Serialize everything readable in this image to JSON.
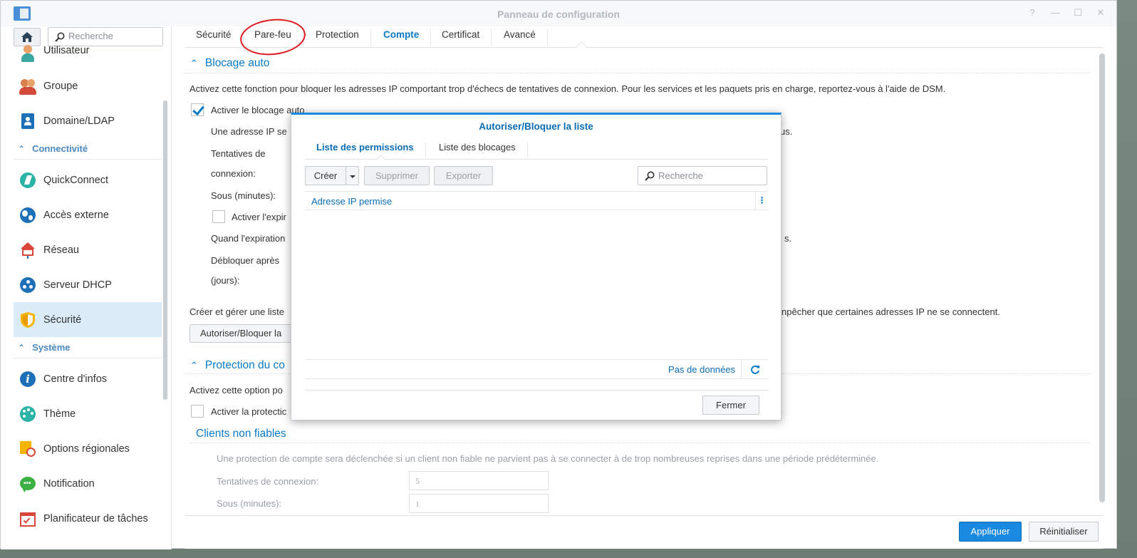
{
  "window": {
    "title": "Panneau de configuration",
    "controls": [
      "?",
      "—",
      "☐",
      "✕"
    ]
  },
  "sidebar": {
    "search_placeholder": "Recherche",
    "items": [
      {
        "label": "Utilisateur",
        "icon": "user-icon"
      },
      {
        "label": "Groupe",
        "icon": "group-icon"
      },
      {
        "label": "Domaine/LDAP",
        "icon": "domain-icon"
      }
    ],
    "section_connectivity": "Connectivité",
    "connectivity_items": [
      {
        "label": "QuickConnect",
        "icon": "quickconnect-icon"
      },
      {
        "label": "Accès externe",
        "icon": "globe-icon"
      },
      {
        "label": "Réseau",
        "icon": "network-house-icon"
      },
      {
        "label": "Serveur DHCP",
        "icon": "dhcp-icon"
      },
      {
        "label": "Sécurité",
        "icon": "shield-icon",
        "active": true
      }
    ],
    "section_system": "Système",
    "system_items": [
      {
        "label": "Centre d'infos",
        "icon": "info-icon"
      },
      {
        "label": "Thème",
        "icon": "palette-icon"
      },
      {
        "label": "Options régionales",
        "icon": "regional-icon"
      },
      {
        "label": "Notification",
        "icon": "chat-icon"
      },
      {
        "label": "Planificateur de tâches",
        "icon": "calendar-check-icon"
      }
    ]
  },
  "tabs": [
    "Sécurité",
    "Pare-feu",
    "Protection",
    "Compte",
    "Certificat",
    "Avancé"
  ],
  "active_tab": "Compte",
  "main": {
    "autoblock": {
      "heading": "Blocage auto",
      "description": "Activez cette fonction pour bloquer les adresses IP comportant trop d'échecs de tentatives de connexion. Pour les services et les paquets pris en charge, reportez-vous à l'aide de DSM.",
      "enable_label": "Activer le blocage auto",
      "enable_checked": true,
      "line1_start": "Une adresse IP se",
      "line1_end": "us.",
      "attempts_label_1": "Tentatives de",
      "attempts_label_2": "connexion:",
      "within_label": "Sous (minutes):",
      "expire_label": "Activer l'expir",
      "expire_checked": false,
      "when_expire_start": "Quand l'expiration",
      "when_expire_end": "s.",
      "unblock_label_1": "Débloquer après",
      "unblock_label_2": "(jours):",
      "manage_start": "Créer et gérer une liste",
      "manage_end": "npêcher que certaines adresses IP ne se connectent.",
      "allow_block_button": "Autoriser/Bloquer la"
    },
    "account_protection": {
      "heading": "Protection du co",
      "description_start": "Activez cette option po",
      "enable_label": "Activer la protectic",
      "enable_checked": false
    },
    "untrusted": {
      "heading": "Clients non fiables",
      "description": "Une protection de compte sera déclenchée si un client non fiable ne parvient pas à se connecter à de trop nombreuses reprises dans une période prédéterminée.",
      "attempts_label": "Tentatives de connexion:",
      "attempts_value": "5",
      "within_label": "Sous (minutes):",
      "within_value": "1"
    }
  },
  "footer": {
    "apply": "Appliquer",
    "reset": "Réinitialiser"
  },
  "dialog": {
    "title": "Autoriser/Bloquer la liste",
    "tabs": [
      "Liste des permissions",
      "Liste des blocages"
    ],
    "active_tab": "Liste des permissions",
    "create": "Créer",
    "delete": "Supprimer",
    "export": "Exporter",
    "search_placeholder": "Recherche",
    "column": "Adresse IP permise",
    "no_data": "Pas de données",
    "close": "Fermer"
  },
  "colors": {
    "accent": "#0a7ac7",
    "primary_button": "#1a8ae0",
    "annotation": "#e0191e"
  }
}
